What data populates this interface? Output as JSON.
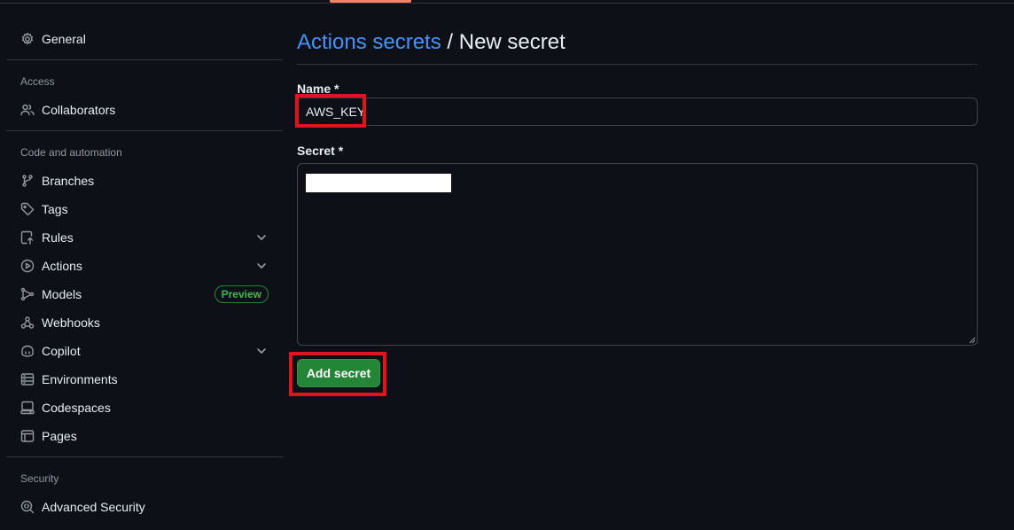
{
  "sidebar": {
    "general": {
      "label": "General",
      "icon": "gear-icon"
    },
    "access_title": "Access",
    "collaborators": {
      "label": "Collaborators",
      "icon": "people-icon"
    },
    "code_title": "Code and automation",
    "items": [
      {
        "label": "Branches",
        "icon": "git-branch-icon"
      },
      {
        "label": "Tags",
        "icon": "tag-icon"
      },
      {
        "label": "Rules",
        "icon": "rules-icon",
        "expandable": true
      },
      {
        "label": "Actions",
        "icon": "play-icon",
        "expandable": true
      },
      {
        "label": "Models",
        "icon": "models-icon",
        "badge": "Preview"
      },
      {
        "label": "Webhooks",
        "icon": "webhook-icon"
      },
      {
        "label": "Copilot",
        "icon": "copilot-icon",
        "expandable": true
      },
      {
        "label": "Environments",
        "icon": "server-icon"
      },
      {
        "label": "Codespaces",
        "icon": "codespaces-icon"
      },
      {
        "label": "Pages",
        "icon": "browser-icon"
      }
    ],
    "security_title": "Security",
    "advanced_security": {
      "label": "Advanced Security",
      "icon": "codescan-icon"
    }
  },
  "main": {
    "breadcrumb_link": "Actions secrets",
    "breadcrumb_sep": " / ",
    "breadcrumb_current": "New secret",
    "name_label": "Name *",
    "name_value": "AWS_KEY",
    "secret_label": "Secret *",
    "submit_label": "Add secret"
  },
  "colors": {
    "background": "#0d1117",
    "link": "#4493f8",
    "primary_button": "#238636",
    "highlight": "#e0141e",
    "tab_accent": "#f78166"
  }
}
